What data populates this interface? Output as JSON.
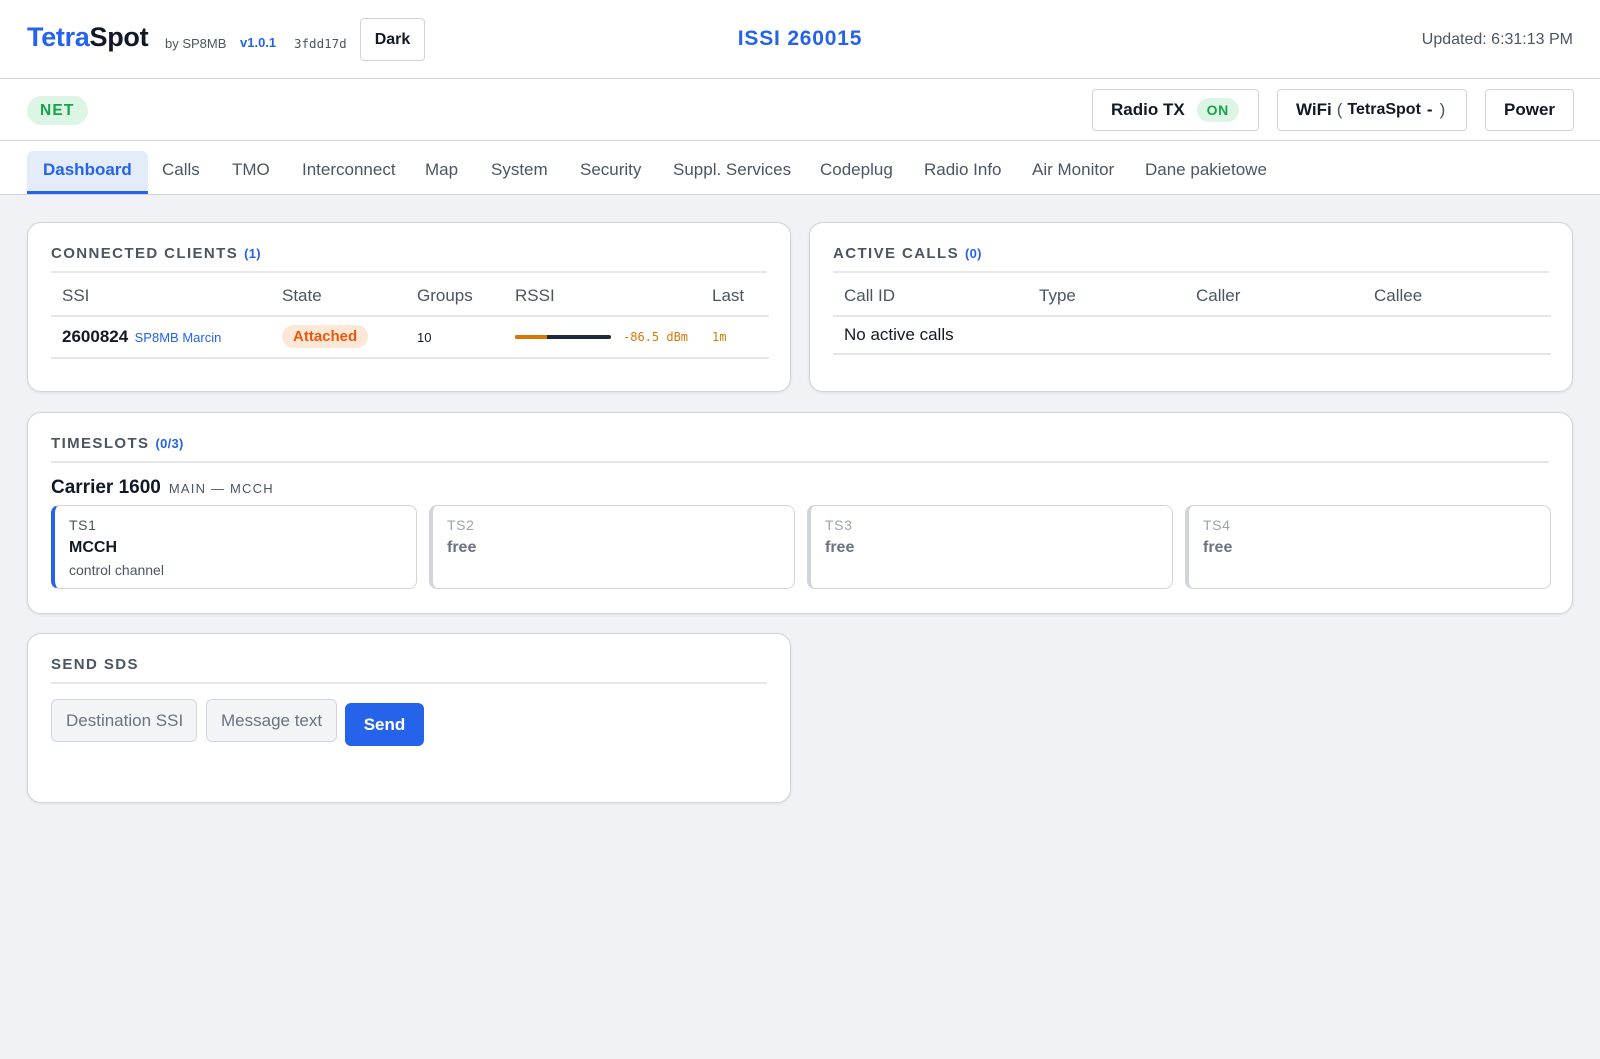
{
  "header": {
    "brand_part1": "Tetra",
    "brand_part2": "Spot",
    "by": "by SP8MB",
    "version": "v1.0.1",
    "hash": "3fdd17d",
    "theme_button": "Dark",
    "issi": "ISSI 260015",
    "updated": "Updated: 6:31:13 PM"
  },
  "status": {
    "net": "NET",
    "radio_tx_label": "Radio TX",
    "radio_tx_state": "ON",
    "wifi_label": "WiFi",
    "wifi_open": "(",
    "wifi_ssid": "TetraSpot",
    "wifi_sep": "-",
    "wifi_close": ")",
    "power": "Power"
  },
  "tabs": [
    {
      "label": "Dashboard",
      "active": true
    },
    {
      "label": "Calls"
    },
    {
      "label": "TMO"
    },
    {
      "label": "Interconnect"
    },
    {
      "label": "Map"
    },
    {
      "label": "System"
    },
    {
      "label": "Security"
    },
    {
      "label": "Suppl. Services"
    },
    {
      "label": "Codeplug"
    },
    {
      "label": "Radio Info"
    },
    {
      "label": "Air Monitor"
    },
    {
      "label": "Dane pakietowe"
    }
  ],
  "clients": {
    "title": "CONNECTED CLIENTS",
    "count": "(1)",
    "columns": [
      "SSI",
      "State",
      "Groups",
      "RSSI",
      "Last"
    ],
    "rows": [
      {
        "ssi": "2600824",
        "name": "SP8MB Marcin",
        "state": "Attached",
        "groups": "10",
        "rssi": "-86.5 dBm",
        "rssi_level": 0.33,
        "last": "1m"
      }
    ]
  },
  "calls": {
    "title": "ACTIVE CALLS",
    "count": "(0)",
    "columns": [
      "Call ID",
      "Type",
      "Caller",
      "Callee"
    ],
    "empty": "No active calls"
  },
  "timeslots": {
    "title": "TIMESLOTS",
    "count": "(0/3)",
    "carrier": "Carrier 1600",
    "carrier_sub": "MAIN — MCCH",
    "slots": [
      {
        "label": "TS1",
        "name": "MCCH",
        "desc": "control channel"
      },
      {
        "label": "TS2",
        "name": "free"
      },
      {
        "label": "TS3",
        "name": "free"
      },
      {
        "label": "TS4",
        "name": "free"
      }
    ]
  },
  "sds": {
    "title": "SEND SDS",
    "dest_placeholder": "Destination SSI",
    "msg_placeholder": "Message text",
    "send": "Send"
  },
  "colors": {
    "accent": "#2563eb",
    "success": "#16a34a",
    "warning": "#d97706",
    "attached": "#ea580c"
  }
}
